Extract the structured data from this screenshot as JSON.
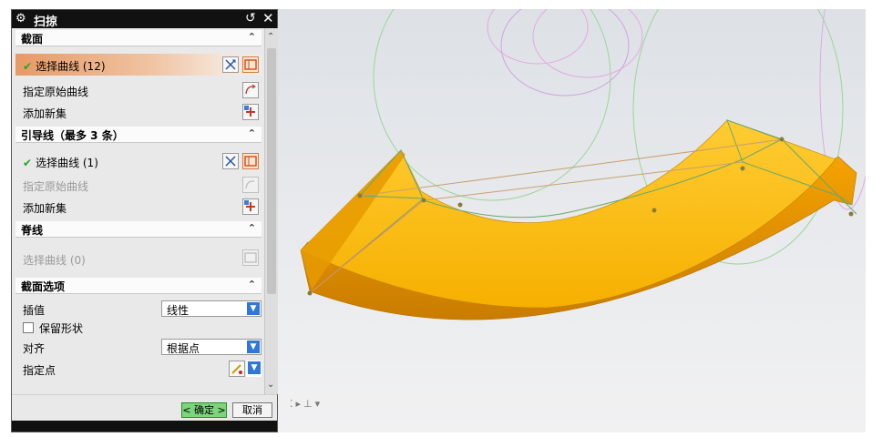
{
  "dialog": {
    "title": "扫掠",
    "icons": {
      "settings": "gear-icon",
      "reset": "reset-icon",
      "close": "close-icon"
    }
  },
  "sections": {
    "section": {
      "header": "截面",
      "select_curve": "选择曲线 (12)",
      "specify_origin_curve": "指定原始曲线",
      "add_new_set": "添加新集"
    },
    "guide": {
      "header": "引导线（最多 3 条）",
      "select_curve": "选择曲线 (1)",
      "specify_origin_curve": "指定原始曲线",
      "add_new_set": "添加新集"
    },
    "spine": {
      "header": "脊线",
      "select_curve": "选择曲线 (0)"
    },
    "section_options": {
      "header": "截面选项",
      "interpolation_label": "插值",
      "interpolation_value": "线性",
      "preserve_shape_label": "保留形状",
      "alignment_label": "对齐",
      "alignment_value": "根据点",
      "specify_point_label": "指定点"
    }
  },
  "more_indicator": "⌄⌄⌄",
  "footer": {
    "ok_label": "< 确定 >",
    "cancel_label": "取消"
  },
  "colors": {
    "solid_body": "#f5a800",
    "selection_highlight": "#e69a66",
    "ok_button": "#7bd67b",
    "dropdown_arrow": "#2f77d8"
  }
}
